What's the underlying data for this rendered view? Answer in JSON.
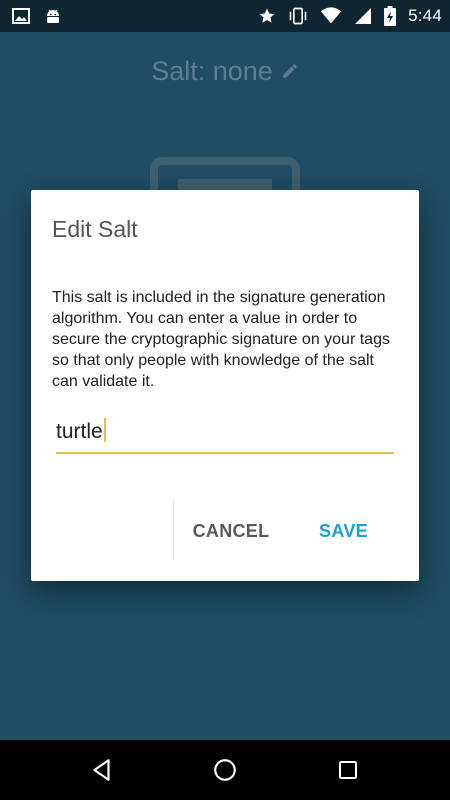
{
  "status_bar": {
    "time": "5:44",
    "left_icons": [
      "image-icon",
      "android-icon"
    ],
    "right_icons": [
      "star-icon",
      "vibrate-icon",
      "wifi-icon",
      "signal-icon",
      "battery-charging-icon"
    ]
  },
  "app": {
    "title": "Salt: none",
    "edit_icon": "pencil-icon"
  },
  "dialog": {
    "title": "Edit Salt",
    "body": "This salt is included in the signature generation algorithm. You can enter a value in order to secure the cryptographic signature on your tags so that only people with knowledge of the salt can validate it.",
    "input_value": "turtle",
    "cancel_label": "CANCEL",
    "save_label": "SAVE"
  },
  "nav_bar": {
    "buttons": [
      "back-icon",
      "home-icon",
      "recents-icon"
    ]
  },
  "colors": {
    "status_bar": "#0e2532",
    "dim_background": "#1f4d63",
    "accent": "#1ba1d8",
    "input_underline": "#e0c24a"
  }
}
